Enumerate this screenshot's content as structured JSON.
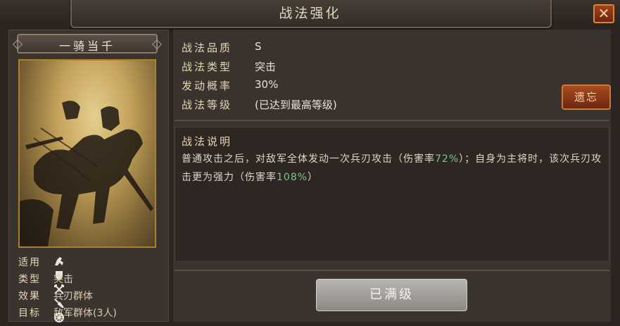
{
  "window": {
    "title": "战法强化",
    "close_symbol": "✕"
  },
  "card": {
    "name": "一骑当千",
    "attributes": [
      {
        "key": "适用",
        "troop_icons": [
          "cavalry-icon",
          "shield-icon",
          "bow-icon",
          "spear-icon",
          "wheel-icon"
        ]
      },
      {
        "key": "类型",
        "value": "突击"
      },
      {
        "key": "效果",
        "value": "兵刃群体"
      },
      {
        "key": "目标",
        "value": "敌军群体(3人)"
      }
    ]
  },
  "info": {
    "quality_key": "战法品质",
    "quality_val": "S",
    "type_key": "战法类型",
    "type_val": "突击",
    "prob_key": "发动概率",
    "prob_val": "30%",
    "level_key": "战法等级",
    "level_val": "(已达到最高等级)"
  },
  "forget_button": "遗忘",
  "description": {
    "title": "战法说明",
    "seg1": "普通攻击之后，对敌军全体发动一次兵刃攻击（伤害率",
    "rate1": "72%",
    "seg2": "）；自身为主将时，该次兵刃攻击更为强力（伤害率",
    "rate2": "108%",
    "seg3": "）"
  },
  "max_button": "已满级",
  "colors": {
    "accent": "#a84b1e",
    "highlight": "#7cc58a",
    "frame_gold": "#a8802e"
  }
}
